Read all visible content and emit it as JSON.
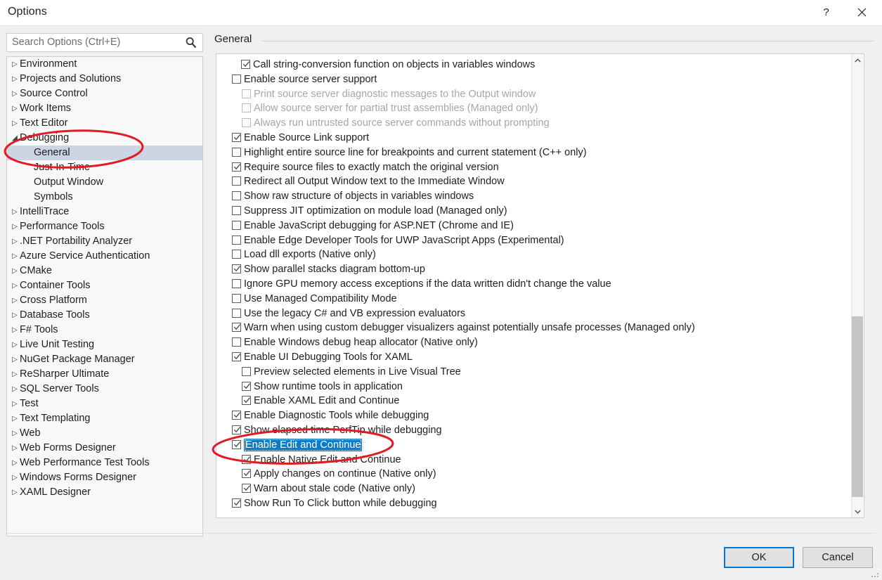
{
  "window": {
    "title": "Options",
    "help_label": "?",
    "close_label": "✕"
  },
  "search": {
    "placeholder": "Search Options (Ctrl+E)",
    "value": "",
    "icon": "search-icon"
  },
  "tree": {
    "items": [
      {
        "label": "Environment",
        "depth": 0,
        "expander": "collapsed",
        "selected": false
      },
      {
        "label": "Projects and Solutions",
        "depth": 0,
        "expander": "collapsed",
        "selected": false
      },
      {
        "label": "Source Control",
        "depth": 0,
        "expander": "collapsed",
        "selected": false
      },
      {
        "label": "Work Items",
        "depth": 0,
        "expander": "collapsed",
        "selected": false
      },
      {
        "label": "Text Editor",
        "depth": 0,
        "expander": "collapsed",
        "selected": false
      },
      {
        "label": "Debugging",
        "depth": 0,
        "expander": "expanded",
        "selected": false
      },
      {
        "label": "General",
        "depth": 1,
        "expander": "none",
        "selected": true
      },
      {
        "label": "Just-In-Time",
        "depth": 1,
        "expander": "none",
        "selected": false
      },
      {
        "label": "Output Window",
        "depth": 1,
        "expander": "none",
        "selected": false
      },
      {
        "label": "Symbols",
        "depth": 1,
        "expander": "none",
        "selected": false
      },
      {
        "label": "IntelliTrace",
        "depth": 0,
        "expander": "collapsed",
        "selected": false
      },
      {
        "label": "Performance Tools",
        "depth": 0,
        "expander": "collapsed",
        "selected": false
      },
      {
        "label": ".NET Portability Analyzer",
        "depth": 0,
        "expander": "collapsed",
        "selected": false
      },
      {
        "label": "Azure Service Authentication",
        "depth": 0,
        "expander": "collapsed",
        "selected": false
      },
      {
        "label": "CMake",
        "depth": 0,
        "expander": "collapsed",
        "selected": false
      },
      {
        "label": "Container Tools",
        "depth": 0,
        "expander": "collapsed",
        "selected": false
      },
      {
        "label": "Cross Platform",
        "depth": 0,
        "expander": "collapsed",
        "selected": false
      },
      {
        "label": "Database Tools",
        "depth": 0,
        "expander": "collapsed",
        "selected": false
      },
      {
        "label": "F# Tools",
        "depth": 0,
        "expander": "collapsed",
        "selected": false
      },
      {
        "label": "Live Unit Testing",
        "depth": 0,
        "expander": "collapsed",
        "selected": false
      },
      {
        "label": "NuGet Package Manager",
        "depth": 0,
        "expander": "collapsed",
        "selected": false
      },
      {
        "label": "ReSharper Ultimate",
        "depth": 0,
        "expander": "collapsed",
        "selected": false
      },
      {
        "label": "SQL Server Tools",
        "depth": 0,
        "expander": "collapsed",
        "selected": false
      },
      {
        "label": "Test",
        "depth": 0,
        "expander": "collapsed",
        "selected": false
      },
      {
        "label": "Text Templating",
        "depth": 0,
        "expander": "collapsed",
        "selected": false
      },
      {
        "label": "Web",
        "depth": 0,
        "expander": "collapsed",
        "selected": false
      },
      {
        "label": "Web Forms Designer",
        "depth": 0,
        "expander": "collapsed",
        "selected": false
      },
      {
        "label": "Web Performance Test Tools",
        "depth": 0,
        "expander": "collapsed",
        "selected": false
      },
      {
        "label": "Windows Forms Designer",
        "depth": 0,
        "expander": "collapsed",
        "selected": false
      },
      {
        "label": "XAML Designer",
        "depth": 0,
        "expander": "collapsed",
        "selected": false
      }
    ]
  },
  "pane": {
    "title": "General"
  },
  "options": [
    {
      "label": "Call string-conversion function on objects in variables windows",
      "checked": true,
      "disabled": false,
      "indent": "ind0b",
      "highlight": false
    },
    {
      "label": "Enable source server support",
      "checked": false,
      "disabled": false,
      "indent": "ind0",
      "highlight": false
    },
    {
      "label": "Print source server diagnostic messages to the Output window",
      "checked": false,
      "disabled": true,
      "indent": "ind1",
      "highlight": false
    },
    {
      "label": "Allow source server for partial trust assemblies (Managed only)",
      "checked": false,
      "disabled": true,
      "indent": "ind1",
      "highlight": false
    },
    {
      "label": "Always run untrusted source server commands without prompting",
      "checked": false,
      "disabled": true,
      "indent": "ind1",
      "highlight": false
    },
    {
      "label": "Enable Source Link support",
      "checked": true,
      "disabled": false,
      "indent": "ind0",
      "highlight": false
    },
    {
      "label": "Highlight entire source line for breakpoints and current statement (C++ only)",
      "checked": false,
      "disabled": false,
      "indent": "ind0",
      "highlight": false
    },
    {
      "label": "Require source files to exactly match the original version",
      "checked": true,
      "disabled": false,
      "indent": "ind0",
      "highlight": false
    },
    {
      "label": "Redirect all Output Window text to the Immediate Window",
      "checked": false,
      "disabled": false,
      "indent": "ind0",
      "highlight": false
    },
    {
      "label": "Show raw structure of objects in variables windows",
      "checked": false,
      "disabled": false,
      "indent": "ind0",
      "highlight": false
    },
    {
      "label": "Suppress JIT optimization on module load (Managed only)",
      "checked": false,
      "disabled": false,
      "indent": "ind0",
      "highlight": false
    },
    {
      "label": "Enable JavaScript debugging for ASP.NET (Chrome and IE)",
      "checked": false,
      "disabled": false,
      "indent": "ind0",
      "highlight": false
    },
    {
      "label": "Enable Edge Developer Tools for UWP JavaScript Apps (Experimental)",
      "checked": false,
      "disabled": false,
      "indent": "ind0",
      "highlight": false
    },
    {
      "label": "Load dll exports (Native only)",
      "checked": false,
      "disabled": false,
      "indent": "ind0",
      "highlight": false
    },
    {
      "label": "Show parallel stacks diagram bottom-up",
      "checked": true,
      "disabled": false,
      "indent": "ind0",
      "highlight": false
    },
    {
      "label": "Ignore GPU memory access exceptions if the data written didn't change the value",
      "checked": false,
      "disabled": false,
      "indent": "ind0",
      "highlight": false
    },
    {
      "label": "Use Managed Compatibility Mode",
      "checked": false,
      "disabled": false,
      "indent": "ind0",
      "highlight": false
    },
    {
      "label": "Use the legacy C# and VB expression evaluators",
      "checked": false,
      "disabled": false,
      "indent": "ind0",
      "highlight": false
    },
    {
      "label": "Warn when using custom debugger visualizers against potentially unsafe processes (Managed only)",
      "checked": true,
      "disabled": false,
      "indent": "ind0",
      "highlight": false
    },
    {
      "label": "Enable Windows debug heap allocator (Native only)",
      "checked": false,
      "disabled": false,
      "indent": "ind0",
      "highlight": false
    },
    {
      "label": "Enable UI Debugging Tools for XAML",
      "checked": true,
      "disabled": false,
      "indent": "ind0",
      "highlight": false
    },
    {
      "label": "Preview selected elements in Live Visual Tree",
      "checked": false,
      "disabled": false,
      "indent": "ind1",
      "highlight": false
    },
    {
      "label": "Show runtime tools in application",
      "checked": true,
      "disabled": false,
      "indent": "ind1",
      "highlight": false
    },
    {
      "label": "Enable XAML Edit and Continue",
      "checked": true,
      "disabled": false,
      "indent": "ind1",
      "highlight": false
    },
    {
      "label": "Enable Diagnostic Tools while debugging",
      "checked": true,
      "disabled": false,
      "indent": "ind0",
      "highlight": false
    },
    {
      "label": "Show elapsed time PerfTip while debugging",
      "checked": true,
      "disabled": false,
      "indent": "ind0",
      "highlight": false
    },
    {
      "label": "Enable Edit and Continue",
      "checked": true,
      "disabled": false,
      "indent": "ind0",
      "highlight": true
    },
    {
      "label": "Enable Native Edit and Continue",
      "checked": true,
      "disabled": false,
      "indent": "ind1",
      "highlight": false
    },
    {
      "label": "Apply changes on continue (Native only)",
      "checked": true,
      "disabled": false,
      "indent": "ind1",
      "highlight": false
    },
    {
      "label": "Warn about stale code (Native only)",
      "checked": true,
      "disabled": false,
      "indent": "ind1",
      "highlight": false
    },
    {
      "label": "Show Run To Click button while debugging",
      "checked": true,
      "disabled": false,
      "indent": "ind0",
      "highlight": false
    }
  ],
  "scrollbar": {
    "up_icon": "chevron-up-icon",
    "down_icon": "chevron-down-icon",
    "thumb_top_pct": 57,
    "thumb_height_pct": 41
  },
  "footer": {
    "ok_label": "OK",
    "cancel_label": "Cancel"
  },
  "annotations": {
    "accent_color": "#e01b24",
    "ellipse_tree": "red-ellipse-around-debugging-general",
    "ellipse_option": "red-ellipse-around-enable-edit-and-continue"
  }
}
